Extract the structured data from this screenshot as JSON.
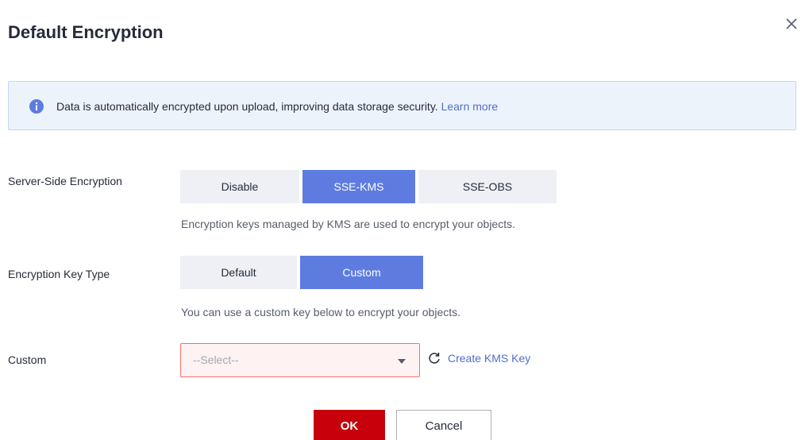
{
  "dialog": {
    "title": "Default Encryption"
  },
  "info": {
    "text": "Data is automatically encrypted upon upload, improving data storage security.",
    "link": "Learn more"
  },
  "sse": {
    "label": "Server-Side Encryption",
    "options": [
      "Disable",
      "SSE-KMS",
      "SSE-OBS"
    ],
    "selected": "SSE-KMS",
    "hint": "Encryption keys managed by KMS are used to encrypt your objects."
  },
  "key_type": {
    "label": "Encryption Key Type",
    "options": [
      "Default",
      "Custom"
    ],
    "selected": "Custom",
    "hint": "You can use a custom key below to encrypt your objects."
  },
  "custom": {
    "label": "Custom",
    "placeholder": "--Select--",
    "create_link": "Create KMS Key"
  },
  "footer": {
    "ok_label": "OK",
    "cancel_label": "Cancel"
  },
  "colors": {
    "accent": "#5e7ce0",
    "primary_button": "#c7000b",
    "link": "#526ecc",
    "error_border": "#f66f6a",
    "info_background": "#edf3fb"
  },
  "icons": [
    "close-icon",
    "info-icon",
    "chevron-down-icon",
    "refresh-icon"
  ]
}
